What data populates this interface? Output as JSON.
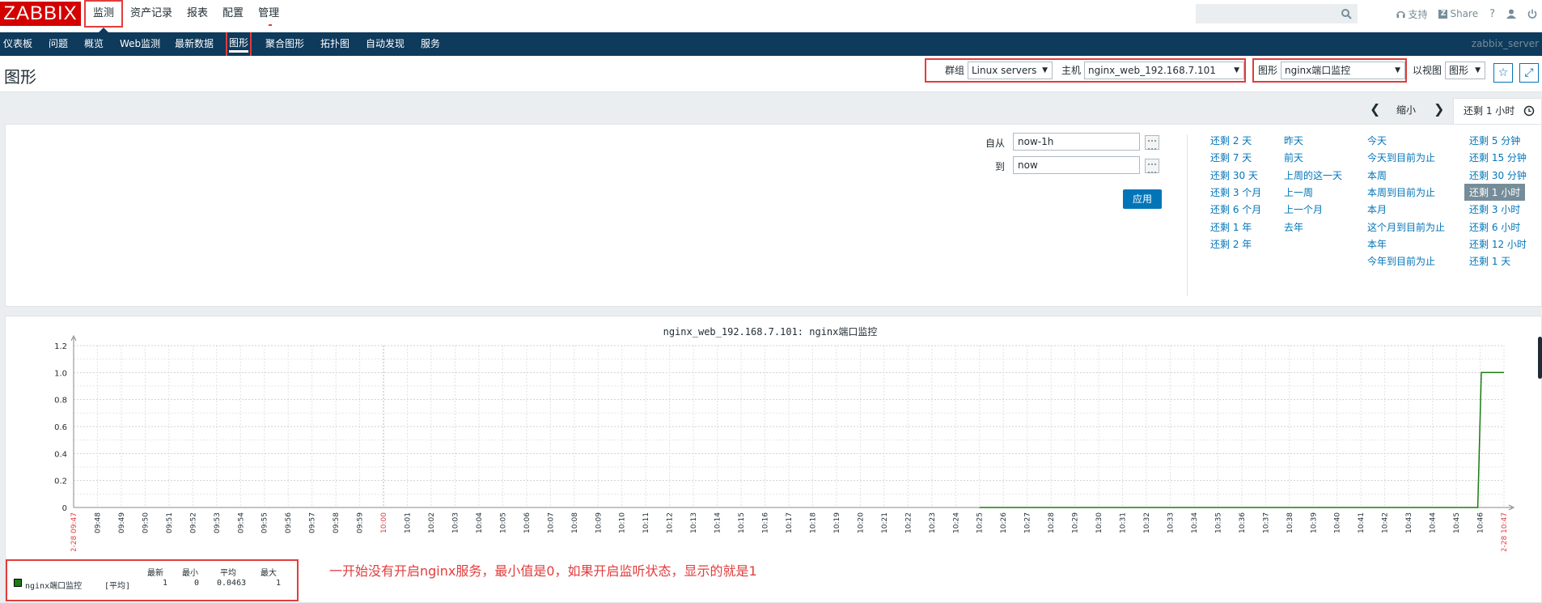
{
  "logo": "ZABBIX",
  "topmenu": [
    "监测",
    "资产记录",
    "报表",
    "配置",
    "管理"
  ],
  "topicons": {
    "support": "支持",
    "share": "Share",
    "help": "?"
  },
  "mainnav": {
    "items": [
      "仪表板",
      "问题",
      "概览",
      "Web监测",
      "最新数据",
      "图形",
      "聚合图形",
      "拓扑图",
      "自动发现",
      "服务"
    ],
    "server": "zabbix_server"
  },
  "header": {
    "title": "图形",
    "group_label": "群组",
    "group_value": "Linux servers",
    "host_label": "主机",
    "host_value": "nginx_web_192.168.7.101",
    "graph_label": "图形",
    "graph_value": "nginx端口监控",
    "view_label": "以视图",
    "view_value": "图形"
  },
  "timebar": {
    "zoom_out": "缩小",
    "tab": "还剩 1 小时"
  },
  "timepanel": {
    "from_label": "自从",
    "from_value": "now-1h",
    "to_label": "到",
    "to_value": "now",
    "apply": "应用",
    "col1": [
      "还剩 2 天",
      "还剩 7 天",
      "还剩 30 天",
      "还剩 3 个月",
      "还剩 6 个月",
      "还剩 1 年",
      "还剩 2 年"
    ],
    "col2": [
      "昨天",
      "前天",
      "上周的这一天",
      "上一周",
      "上一个月",
      "去年"
    ],
    "col3": [
      "今天",
      "今天到目前为止",
      "本周",
      "本周到目前为止",
      "本月",
      "这个月到目前为止",
      "本年",
      "今年到目前为止"
    ],
    "col4": [
      "还剩 5 分钟",
      "还剩 15 分钟",
      "还剩 30 分钟",
      "还剩 1 小时",
      "还剩 3 小时",
      "还剩 6 小时",
      "还剩 12 小时",
      "还剩 1 天"
    ],
    "col4_selected": 3
  },
  "graph": {
    "title": "nginx_web_192.168.7.101: nginx端口监控",
    "legend_headers": [
      "最新",
      "最小",
      "平均",
      "最大"
    ],
    "legend_name": "nginx端口监控",
    "legend_func": "[平均]",
    "legend_values": [
      "1",
      "0",
      "0.0463",
      "1"
    ],
    "annotation": "一开始没有开启nginx服务，最小值是0，如果开启监听状态，显示的就是1",
    "start_label": "02-28 09:47",
    "end_label": "02-28 10:47",
    "line_color": "#1a7c11"
  },
  "chart_data": {
    "type": "line",
    "title": "nginx_web_192.168.7.101: nginx端口监控",
    "ylim": [
      0,
      1.2
    ],
    "yticks": [
      "0",
      "0.2",
      "0.4",
      "0.6",
      "0.8",
      "1.0",
      "1.2"
    ],
    "xticks": [
      "09:48",
      "09:49",
      "09:50",
      "09:51",
      "09:52",
      "09:53",
      "09:54",
      "09:55",
      "09:56",
      "09:57",
      "09:58",
      "09:59",
      "10:00",
      "10:01",
      "10:02",
      "10:03",
      "10:04",
      "10:05",
      "10:06",
      "10:07",
      "10:08",
      "10:09",
      "10:10",
      "10:11",
      "10:12",
      "10:13",
      "10:14",
      "10:15",
      "10:16",
      "10:17",
      "10:18",
      "10:19",
      "10:20",
      "10:21",
      "10:22",
      "10:23",
      "10:24",
      "10:25",
      "10:26",
      "10:27",
      "10:28",
      "10:29",
      "10:30",
      "10:31",
      "10:32",
      "10:33",
      "10:34",
      "10:35",
      "10:36",
      "10:37",
      "10:38",
      "10:39",
      "10:40",
      "10:41",
      "10:42",
      "10:43",
      "10:44",
      "10:45",
      "10:46"
    ],
    "series": [
      {
        "name": "nginx端口监控",
        "points": [
          [
            "10:25",
            0
          ],
          [
            "10:45.9",
            0
          ],
          [
            "10:46.05",
            1
          ],
          [
            "10:47",
            1
          ]
        ]
      }
    ],
    "grid": true
  }
}
